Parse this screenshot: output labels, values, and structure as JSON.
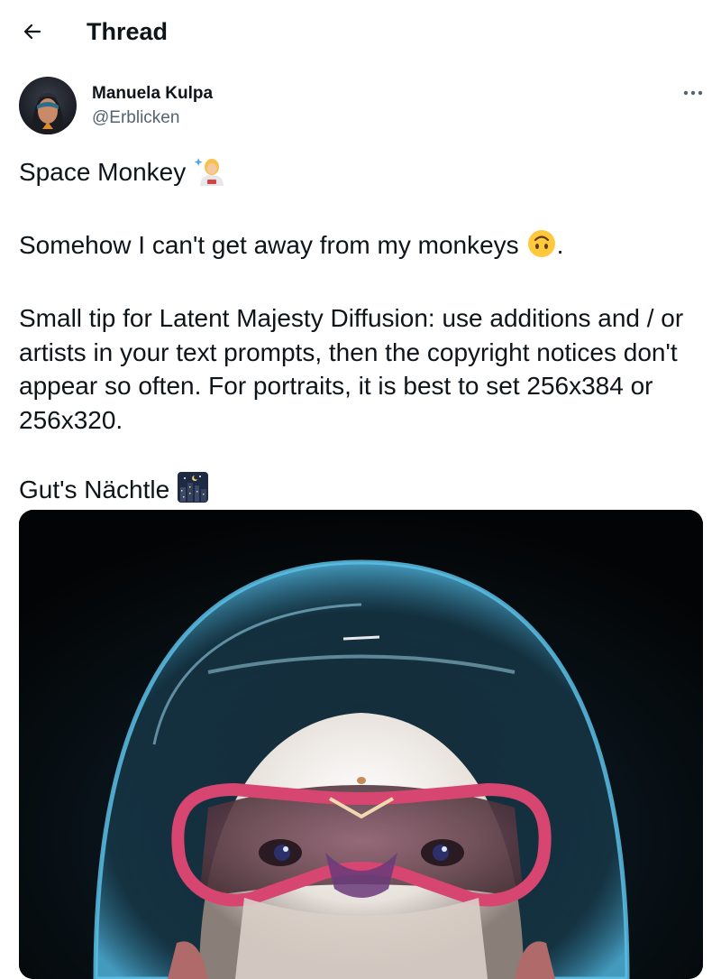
{
  "header": {
    "title": "Thread",
    "back_icon": "arrow-left-icon"
  },
  "author": {
    "name": "Manuela Kulpa",
    "handle": "@Erblicken",
    "more_icon": "more-horizontal-icon"
  },
  "tweet": {
    "line1": "Space Monkey",
    "line2": "Somehow I can't get away from my monkeys",
    "line2_suffix": ".",
    "paragraph3": "Small tip for Latent Majesty Diffusion: use additions and / or artists in your text prompts, then the copyright notices don't appear so often. For portraits, it is best to set 256x384 or 256x320.",
    "line4": "Gut's Nächtle",
    "emojis": [
      "astronaut-emoji",
      "upside-down-face-emoji",
      "night-city-emoji"
    ]
  },
  "media": {
    "icon": "space-monkey-image"
  },
  "colors": {
    "text": "#0f1419",
    "secondary": "#536471",
    "background": "#ffffff"
  }
}
